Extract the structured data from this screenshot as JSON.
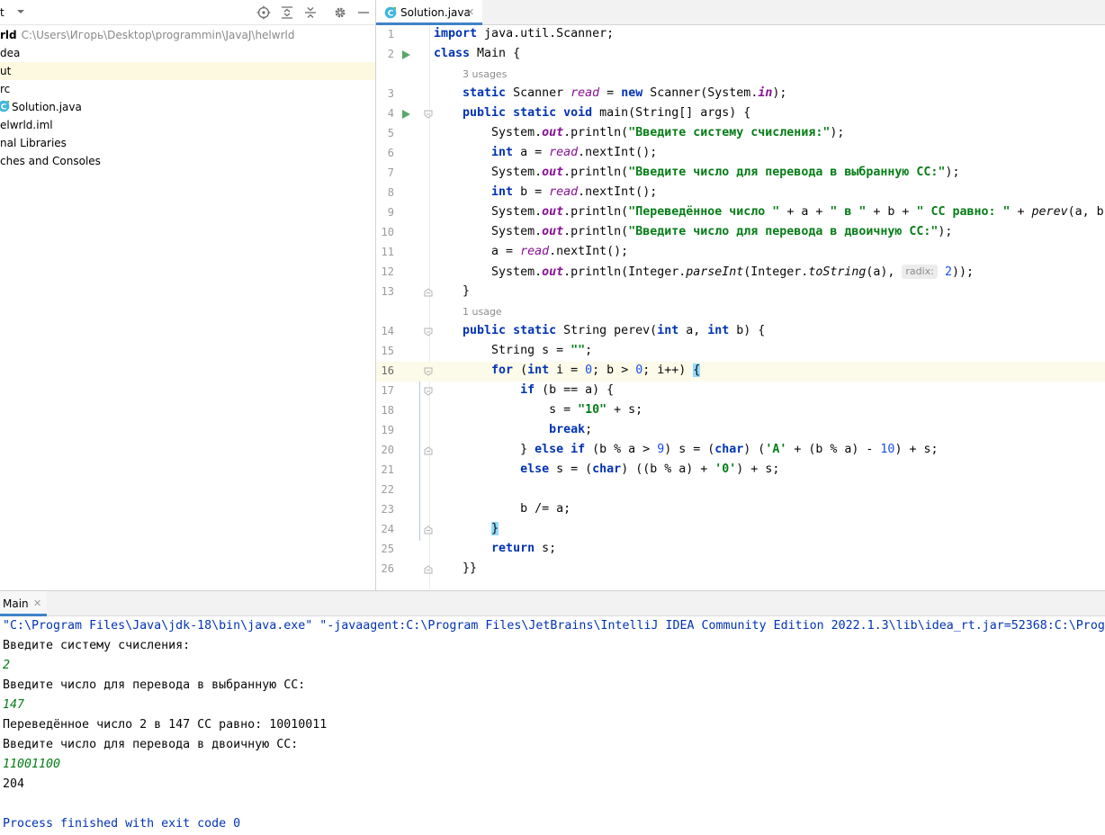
{
  "project_panel": {
    "title": "t",
    "tree": [
      {
        "text": "rld",
        "path": "C:\\Users\\Игорь\\Desktop\\programmin\\JavaJ\\helwrld",
        "root": true
      },
      {
        "text": "dea"
      },
      {
        "text": "ut",
        "selected": true
      },
      {
        "text": "rc"
      },
      {
        "text": "Solution.java",
        "file": true
      },
      {
        "text": "elwrld.iml"
      },
      {
        "text": "nal Libraries"
      },
      {
        "text": "ches and Consoles"
      }
    ]
  },
  "editor": {
    "tab": {
      "label": "Solution.java"
    },
    "usages": {
      "main_read": "3 usages",
      "perev": "1 usage"
    },
    "inlay_hint": "radix:",
    "line_numbers": [
      "1",
      "2",
      "3",
      "4",
      "5",
      "6",
      "7",
      "8",
      "9",
      "10",
      "11",
      "12",
      "13",
      "14",
      "15",
      "16",
      "17",
      "18",
      "19",
      "20",
      "21",
      "22",
      "23",
      "24",
      "25",
      "26"
    ]
  },
  "run_panel": {
    "tab_label": "Main",
    "console": [
      {
        "text": "\"C:\\Program Files\\Java\\jdk-18\\bin\\java.exe\" \"-javaagent:C:\\Program Files\\JetBrains\\IntelliJ IDEA Community Edition 2022.1.3\\lib\\idea_rt.jar=52368:C:\\Prog",
        "kind": "sys"
      },
      {
        "text": "Введите систему счисления:",
        "kind": "out"
      },
      {
        "text": "2",
        "kind": "input"
      },
      {
        "text": "Введите число для перевода в выбранную СС:",
        "kind": "out"
      },
      {
        "text": "147",
        "kind": "input"
      },
      {
        "text": "Переведённое число 2 в 147 СС равно: 10010011",
        "kind": "out"
      },
      {
        "text": "Введите число для перевода в двоичную СС:",
        "kind": "out"
      },
      {
        "text": "11001100",
        "kind": "input"
      },
      {
        "text": "204",
        "kind": "out"
      },
      {
        "text": "",
        "kind": "out"
      },
      {
        "text": "Process finished with exit code 0",
        "kind": "sys"
      }
    ]
  },
  "colors": {
    "keyword": "#0033b3",
    "string": "#067d17",
    "number": "#1750eb",
    "field": "#871094",
    "accent": "#4083c9",
    "current_line": "#fcfae9",
    "selected_row": "#fcf9e0"
  }
}
